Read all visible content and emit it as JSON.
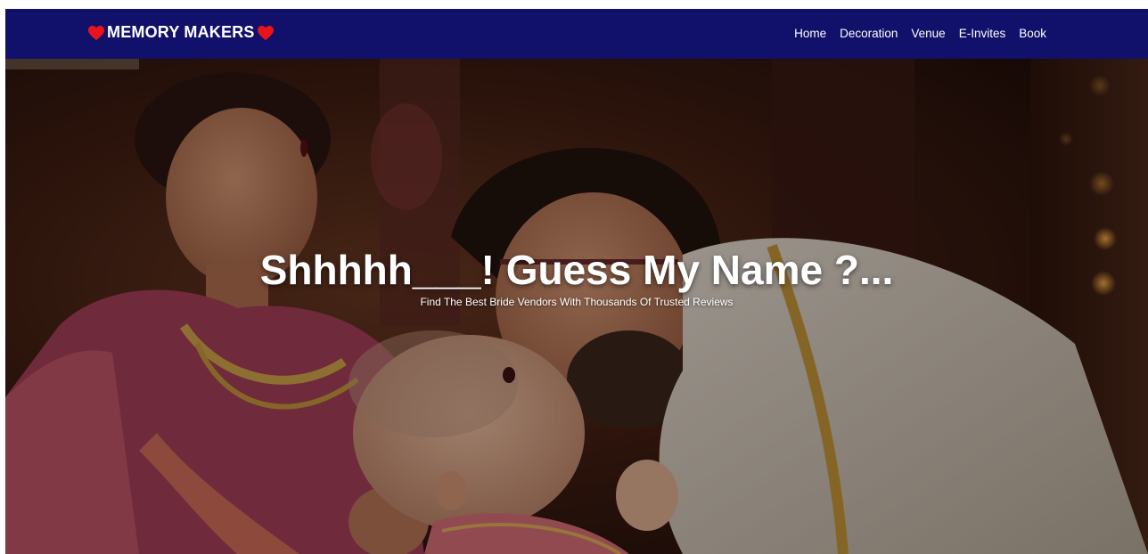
{
  "navbar": {
    "brand": "MEMORY MAKERS",
    "brand_icon": "heart-icon",
    "brand_icon_color": "#e8141c",
    "background_color": "#11106b",
    "links": [
      {
        "label": "Home"
      },
      {
        "label": "Decoration"
      },
      {
        "label": "Venue"
      },
      {
        "label": "E-Invites"
      },
      {
        "label": "Book"
      }
    ]
  },
  "hero": {
    "title": "Shhhhh___! Guess My Name ?...",
    "subtitle": "Find The Best Bride Vendors With Thousands Of Trusted Reviews"
  }
}
